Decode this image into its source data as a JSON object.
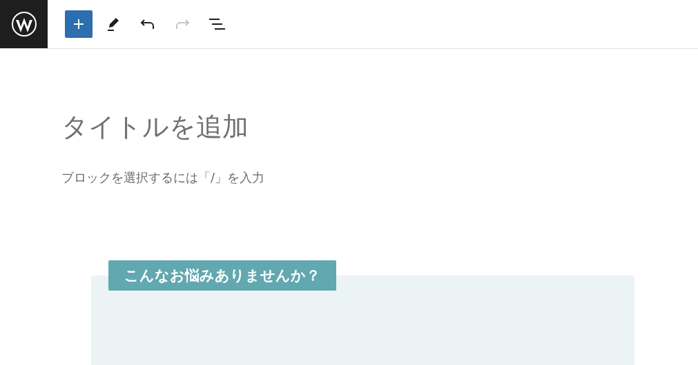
{
  "toolbar": {
    "buttons": [
      {
        "kind": "add",
        "disabled": false
      },
      {
        "kind": "edit",
        "disabled": false
      },
      {
        "kind": "undo",
        "disabled": false
      },
      {
        "kind": "redo",
        "disabled": true
      },
      {
        "kind": "outline",
        "disabled": false
      }
    ]
  },
  "editor": {
    "title_placeholder": "タイトルを追加",
    "block_placeholder": "ブロックを選択するには「/」を入力",
    "box": {
      "heading": "こんなお悩みありませんか？"
    }
  }
}
